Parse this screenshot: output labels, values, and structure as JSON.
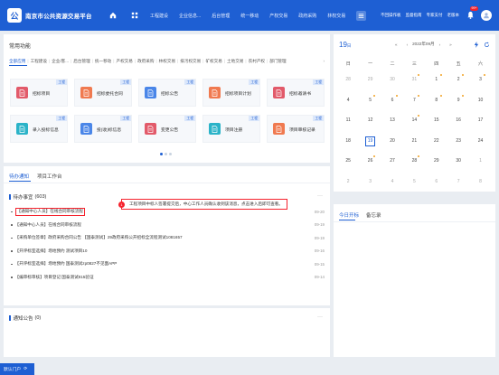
{
  "header": {
    "logo_char": "公",
    "title": "南京市公共资源交易平台",
    "nav_items": [
      "工程建设",
      "企业信息...",
      "后台管理",
      "统一移动",
      "产权交易",
      "政府采购",
      "林权交易"
    ],
    "links": [
      "不回操作板",
      "监督指南",
      "专家支付",
      "老版本"
    ],
    "badge": "99+"
  },
  "common": {
    "title": "常用功能",
    "categories": [
      "全部应用",
      "工程建设",
      "企业/客...",
      "后台管理",
      "统一移动",
      "产权交易",
      "政府采购",
      "林权交易",
      "排污权交易",
      "矿权交易",
      "土地交易",
      "农村产权",
      "部门管理"
    ],
    "more": "›",
    "cards": [
      {
        "label": "招标项目",
        "corner": "工程",
        "color": "#e25a6a"
      },
      {
        "label": "招标委托合同",
        "corner": "工程",
        "color": "#f07a50"
      },
      {
        "label": "招标公告",
        "corner": "工程",
        "color": "#4a86e8"
      },
      {
        "label": "招标项目计划",
        "corner": "工程",
        "color": "#f07a50"
      },
      {
        "label": "招标邀请书",
        "corner": "工程",
        "color": "#e25a6a"
      },
      {
        "label": "录入投标信息",
        "corner": "工程",
        "color": "#2bb3c8"
      },
      {
        "label": "投(收)标信息",
        "corner": "工程",
        "color": "#4a86e8"
      },
      {
        "label": "变更公告",
        "corner": "工程",
        "color": "#e25a6a"
      },
      {
        "label": "项目注册",
        "corner": "工程",
        "color": "#2bb3c8"
      },
      {
        "label": "项目审核记录",
        "corner": "工程",
        "color": "#f07a50"
      }
    ]
  },
  "calendar": {
    "day": "19",
    "day_suffix": "日",
    "month_label": "2022年09月",
    "weekdays": [
      "日",
      "一",
      "二",
      "三",
      "四",
      "五",
      "六"
    ],
    "weeks": [
      [
        {
          "d": "28",
          "o": true
        },
        {
          "d": "29",
          "o": true
        },
        {
          "d": "30",
          "o": true
        },
        {
          "d": "31",
          "o": true,
          "m": true
        },
        {
          "d": "1",
          "m": true
        },
        {
          "d": "2",
          "m": true
        },
        {
          "d": "3",
          "m": true
        }
      ],
      [
        {
          "d": "4"
        },
        {
          "d": "5",
          "m": true
        },
        {
          "d": "6",
          "m": true
        },
        {
          "d": "7",
          "m": true
        },
        {
          "d": "8",
          "m": true
        },
        {
          "d": "9",
          "m": true
        },
        {
          "d": "10"
        }
      ],
      [
        {
          "d": "11"
        },
        {
          "d": "12"
        },
        {
          "d": "13"
        },
        {
          "d": "14",
          "m": true
        },
        {
          "d": "15"
        },
        {
          "d": "16"
        },
        {
          "d": "17"
        }
      ],
      [
        {
          "d": "18"
        },
        {
          "d": "19",
          "t": true
        },
        {
          "d": "20"
        },
        {
          "d": "21"
        },
        {
          "d": "22"
        },
        {
          "d": "23"
        },
        {
          "d": "24"
        }
      ],
      [
        {
          "d": "25"
        },
        {
          "d": "26",
          "m": true
        },
        {
          "d": "27"
        },
        {
          "d": "28",
          "m": true
        },
        {
          "d": "29"
        },
        {
          "d": "30"
        },
        {
          "d": "1",
          "o": true
        }
      ],
      [
        {
          "d": "2",
          "o": true
        },
        {
          "d": "3",
          "o": true
        },
        {
          "d": "4",
          "o": true
        },
        {
          "d": "5",
          "o": true
        },
        {
          "d": "6",
          "o": true
        },
        {
          "d": "7",
          "o": true
        },
        {
          "d": "8",
          "o": true
        }
      ]
    ]
  },
  "todo": {
    "tabs": [
      "待办通知",
      "项目工作台"
    ],
    "section_title": "待办事宜",
    "section_count": "(603)",
    "more": "···",
    "tooltip": "工程项目中标人签署提交后，中心工作人员确认收到该消息，点击进入后即可查看。",
    "tooltip_num": "1",
    "items": [
      {
        "text": "【通知中心人员】在线合同审核流程",
        "date": "09-20",
        "highlight": true
      },
      {
        "text": "【通知中心人员】在线合同审核流程",
        "date": "09-19"
      },
      {
        "text": "【采购单位签章】政府采购合同公告 【国泰测试】29政府采购公开招标全流程测试1081657",
        "date": "09-19"
      },
      {
        "text": "【开评标室选择】场地预约 测试项目10",
        "date": "09-16"
      },
      {
        "text": "【开评标室选择】场地预约 国泰测试zp0827不见面APP",
        "date": "09-15"
      },
      {
        "text": "【编审标审核】项目登记 国泰测试815验证",
        "date": "09-14"
      }
    ]
  },
  "notice": {
    "title": "通知公告",
    "count": "(0)",
    "more": "···"
  },
  "work": {
    "tabs": [
      "今日开标",
      "备忘录"
    ]
  },
  "footer": {
    "label": "默认门户"
  }
}
